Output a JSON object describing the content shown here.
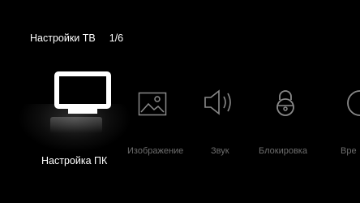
{
  "header": {
    "title": "Настройки ТВ",
    "page": "1/6"
  },
  "menu": {
    "items": [
      {
        "label": "Настройка ПК",
        "icon": "monitor-icon",
        "selected": true
      },
      {
        "label": "Изображение",
        "icon": "picture-icon",
        "selected": false
      },
      {
        "label": "Звук",
        "icon": "speaker-icon",
        "selected": false
      },
      {
        "label": "Блокировка",
        "icon": "lock-icon",
        "selected": false
      },
      {
        "label": "Вре",
        "icon": "clock-icon",
        "selected": false
      }
    ]
  },
  "colors": {
    "background": "#000000",
    "selected_text": "#ffffff",
    "unselected_text": "#6e6e6e"
  }
}
